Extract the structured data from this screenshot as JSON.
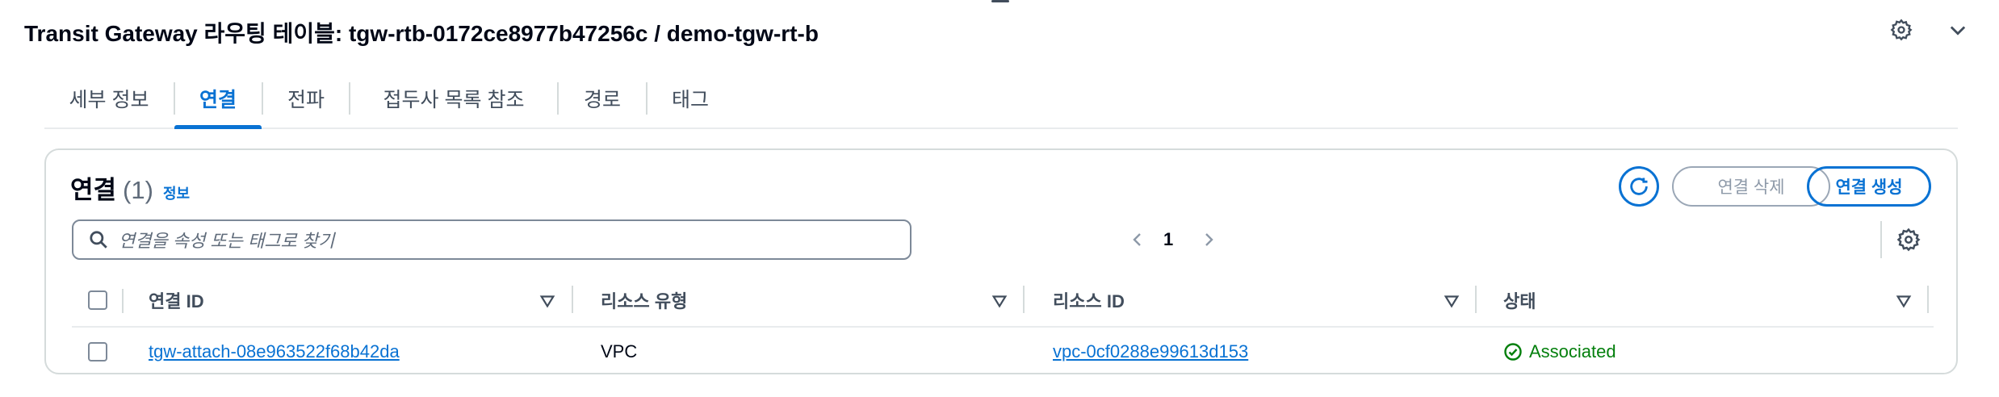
{
  "header": {
    "title": "Transit Gateway 라우팅 테이블: tgw-rtb-0172ce8977b47256c / demo-tgw-rt-b"
  },
  "tabs": [
    {
      "label": "세부 정보",
      "active": false
    },
    {
      "label": "연결",
      "active": true
    },
    {
      "label": "전파",
      "active": false
    },
    {
      "label": "접두사 목록 참조",
      "active": false
    },
    {
      "label": "경로",
      "active": false
    },
    {
      "label": "태그",
      "active": false
    }
  ],
  "panel": {
    "title": "연결",
    "count": "(1)",
    "info_link": "정보",
    "delete_label": "연결 삭제",
    "create_label": "연결 생성",
    "search_placeholder": "연결을 속성 또는 태그로 찾기",
    "page_number": "1"
  },
  "table": {
    "columns": [
      "연결 ID",
      "리소스 유형",
      "리소스 ID",
      "상태"
    ],
    "rows": [
      {
        "attachment_id": "tgw-attach-08e963522f68b42da",
        "resource_type": "VPC",
        "resource_id": "vpc-0cf0288e99613d153",
        "status": "Associated"
      }
    ]
  },
  "colors": {
    "accent": "#0972d3",
    "success": "#037f0c",
    "text": "#000716",
    "border": "#d5dbdb"
  },
  "icons": [
    "settings-icon",
    "chevron-down-icon",
    "refresh-icon",
    "search-icon",
    "chevron-left-icon",
    "chevron-right-icon",
    "sort-icon",
    "status-success-icon"
  ]
}
